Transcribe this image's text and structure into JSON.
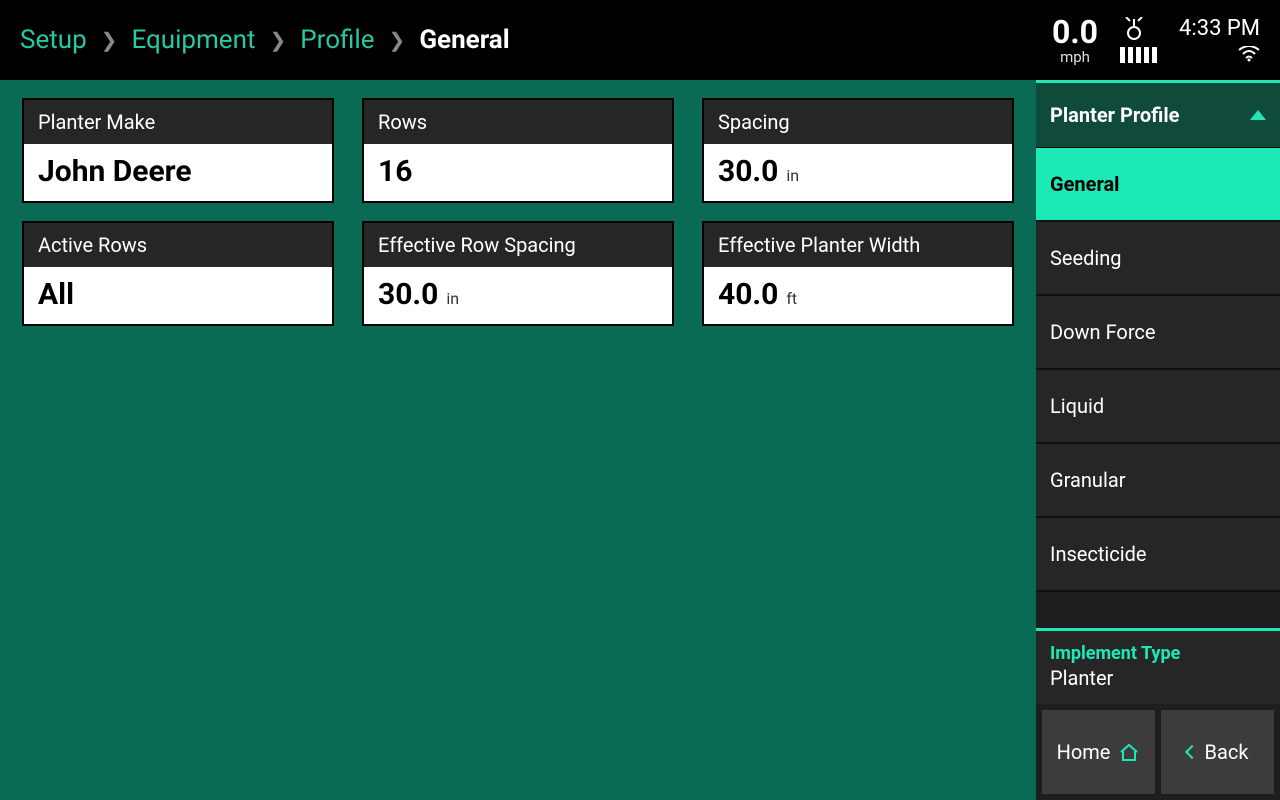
{
  "breadcrumb": {
    "setup": "Setup",
    "equipment": "Equipment",
    "profile": "Profile",
    "current": "General"
  },
  "status": {
    "speed_value": "0.0",
    "speed_unit": "mph",
    "time": "4:33 PM"
  },
  "fields": {
    "planter_make": {
      "label": "Planter Make",
      "value": "John Deere",
      "unit": ""
    },
    "rows": {
      "label": "Rows",
      "value": "16",
      "unit": ""
    },
    "spacing": {
      "label": "Spacing",
      "value": "30.0",
      "unit": "in"
    },
    "active_rows": {
      "label": "Active Rows",
      "value": "All",
      "unit": ""
    },
    "eff_row_spacing": {
      "label": "Effective Row Spacing",
      "value": "30.0",
      "unit": "in"
    },
    "eff_planter_width": {
      "label": "Effective Planter Width",
      "value": "40.0",
      "unit": "ft"
    }
  },
  "sidebar": {
    "header": "Planter Profile",
    "items": [
      {
        "label": "General",
        "active": true
      },
      {
        "label": "Seeding",
        "active": false
      },
      {
        "label": "Down Force",
        "active": false
      },
      {
        "label": "Liquid",
        "active": false
      },
      {
        "label": "Granular",
        "active": false
      },
      {
        "label": "Insecticide",
        "active": false
      }
    ]
  },
  "implement": {
    "label": "Implement Type",
    "value": "Planter"
  },
  "buttons": {
    "home": "Home",
    "back": "Back"
  }
}
